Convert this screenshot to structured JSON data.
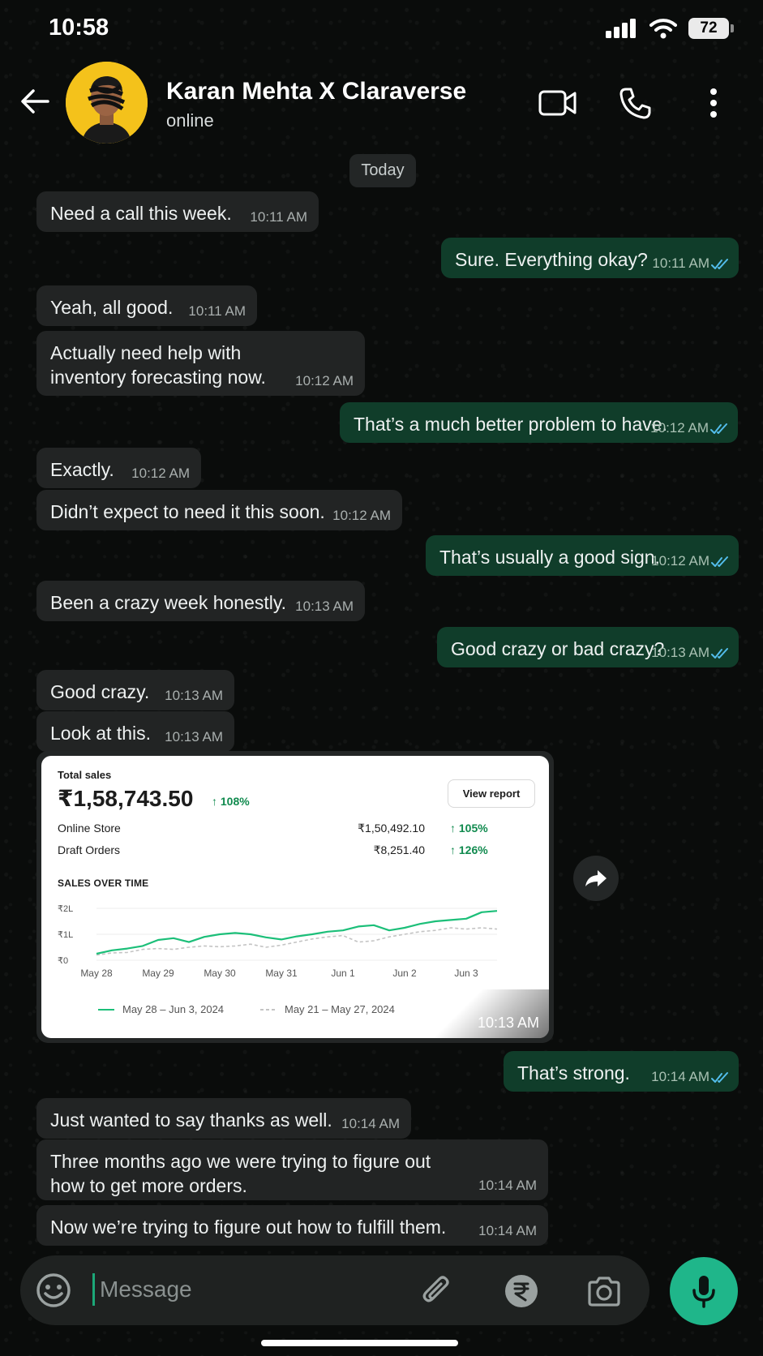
{
  "status_bar": {
    "time": "10:58",
    "battery": "72"
  },
  "header": {
    "contact_name": "Karan Mehta X Claraverse",
    "contact_status": "online",
    "icons": [
      "back-arrow-icon",
      "video-call-icon",
      "phone-icon",
      "more-vertical-icon"
    ]
  },
  "date_chip": "Today",
  "messages": [
    {
      "dir": "in",
      "text": "Need a call this week.",
      "time": "10:11 AM"
    },
    {
      "dir": "out",
      "text": "Sure. Everything okay?",
      "time": "10:11 AM"
    },
    {
      "dir": "in",
      "text": "Yeah, all good.",
      "time": "10:11 AM"
    },
    {
      "dir": "in",
      "text": "Actually need help with\ninventory forecasting now.",
      "time": "10:12 AM"
    },
    {
      "dir": "out",
      "text": "That’s a much better problem to have.",
      "time": "10:12 AM"
    },
    {
      "dir": "in",
      "text": "Exactly.",
      "time": "10:12 AM"
    },
    {
      "dir": "in",
      "text": "Didn’t expect to need it this soon.",
      "time": "10:12 AM"
    },
    {
      "dir": "out",
      "text": "That’s usually a good sign.",
      "time": "10:12 AM"
    },
    {
      "dir": "in",
      "text": "Been a crazy week honestly.",
      "time": "10:13 AM"
    },
    {
      "dir": "out",
      "text": "Good crazy or bad crazy?",
      "time": "10:13 AM"
    },
    {
      "dir": "in",
      "text": "Good crazy.",
      "time": "10:13 AM"
    },
    {
      "dir": "in",
      "text": "Look at this.",
      "time": "10:13 AM"
    },
    {
      "dir": "out",
      "text": "That’s strong.",
      "time": "10:14 AM"
    },
    {
      "dir": "in",
      "text": "Just wanted to say thanks as well.",
      "time": "10:14 AM"
    },
    {
      "dir": "in",
      "text": "Three months ago we were trying to figure out\nhow to get more orders.",
      "time": "10:14 AM"
    },
    {
      "dir": "in",
      "text": "Now we’re trying to figure out how to fulfill them.",
      "time": "10:14 AM"
    }
  ],
  "image_message": {
    "time": "10:13 AM",
    "card": {
      "label": "Total sales",
      "total": "₹1,58,743.50",
      "total_growth": "↑ 108%",
      "view_report": "View report",
      "rows": [
        {
          "label": "Online Store",
          "value": "₹1,50,492.10",
          "growth": "↑ 105%"
        },
        {
          "label": "Draft Orders",
          "value": "₹8,251.40",
          "growth": "↑ 126%"
        }
      ],
      "chart_title": "SALES OVER TIME"
    }
  },
  "chart_data": {
    "type": "line",
    "title": "SALES OVER TIME",
    "y_ticks": [
      "₹2L",
      "₹1L",
      "₹0"
    ],
    "ylim": [
      0,
      2
    ],
    "x_tick_labels": [
      "May 28",
      "May 29",
      "May 30",
      "May 31",
      "Jun 1",
      "Jun 2",
      "Jun 3"
    ],
    "xlim": [
      0,
      6.5
    ],
    "legend_position": "bottom",
    "series": [
      {
        "name": "May 28 – Jun 3, 2024",
        "style": "solid",
        "color": "#1cbf79",
        "x": [
          0,
          0.25,
          0.5,
          0.75,
          1.0,
          1.25,
          1.5,
          1.75,
          2.0,
          2.25,
          2.5,
          2.75,
          3.0,
          3.25,
          3.5,
          3.75,
          4.0,
          4.25,
          4.5,
          4.75,
          5.0,
          5.25,
          5.5,
          5.75,
          6.0,
          6.25,
          6.5
        ],
        "y": [
          0.25,
          0.38,
          0.45,
          0.55,
          0.78,
          0.85,
          0.7,
          0.9,
          1.0,
          1.05,
          1.0,
          0.88,
          0.8,
          0.92,
          1.0,
          1.1,
          1.15,
          1.3,
          1.35,
          1.15,
          1.25,
          1.4,
          1.5,
          1.55,
          1.6,
          1.85,
          1.9
        ]
      },
      {
        "name": "May 21 – May 27, 2024",
        "style": "dashed",
        "color": "#c4c4c4",
        "x": [
          0,
          0.25,
          0.5,
          0.75,
          1.0,
          1.25,
          1.5,
          1.75,
          2.0,
          2.25,
          2.5,
          2.75,
          3.0,
          3.25,
          3.5,
          3.75,
          4.0,
          4.25,
          4.5,
          4.75,
          5.0,
          5.25,
          5.5,
          5.75,
          6.0,
          6.25,
          6.5
        ],
        "y": [
          0.2,
          0.28,
          0.3,
          0.42,
          0.45,
          0.42,
          0.5,
          0.55,
          0.52,
          0.55,
          0.62,
          0.5,
          0.58,
          0.7,
          0.82,
          0.9,
          0.95,
          0.7,
          0.75,
          0.9,
          1.0,
          1.1,
          1.15,
          1.25,
          1.2,
          1.25,
          1.2
        ]
      }
    ]
  },
  "composer": {
    "placeholder": "Message",
    "icons": [
      "emoji-icon",
      "attach-icon",
      "rupee-payment-icon",
      "camera-icon",
      "mic-icon"
    ]
  },
  "colors": {
    "incoming_bubble": "#222424",
    "outgoing_bubble": "#103d2a",
    "accent_green": "#1fb68a",
    "read_ticks": "#53bdeb"
  }
}
